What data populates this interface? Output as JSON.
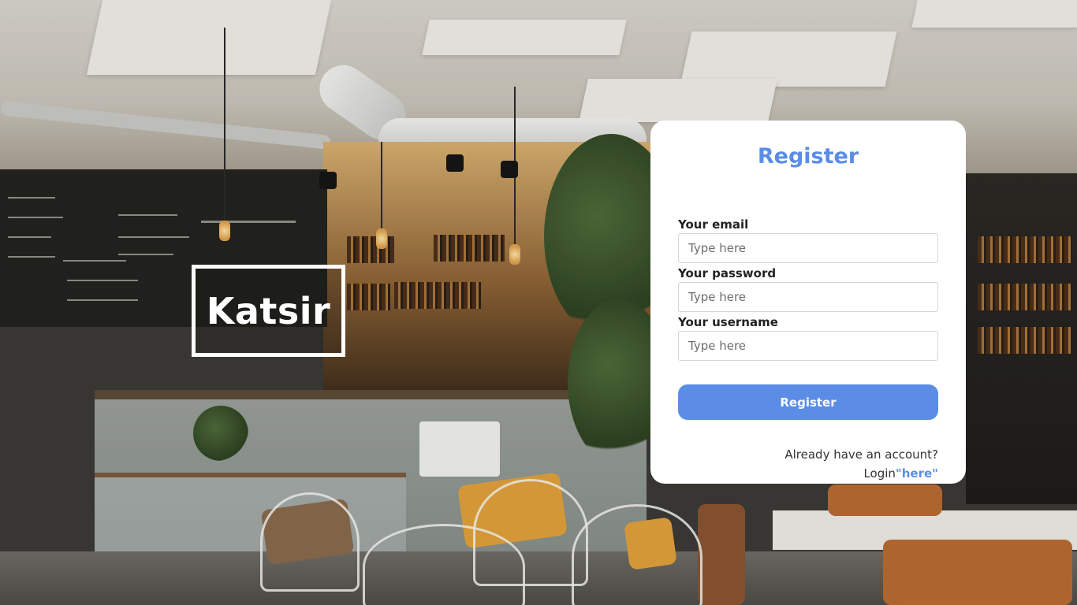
{
  "brand": {
    "logo_text": "Katsir"
  },
  "register_form": {
    "title": "Register",
    "fields": [
      {
        "label": "Your email",
        "placeholder": "Type here",
        "value": ""
      },
      {
        "label": "Your password",
        "placeholder": "Type here",
        "value": ""
      },
      {
        "label": "Your username",
        "placeholder": "Type here",
        "value": ""
      }
    ],
    "submit_label": "Register",
    "footer": {
      "question": "Already have an account?",
      "login_prefix": "Login",
      "login_link": "\"here\""
    }
  },
  "colors": {
    "accent": "#5b8de6",
    "card_background": "#ffffff",
    "label_text": "#222222"
  }
}
